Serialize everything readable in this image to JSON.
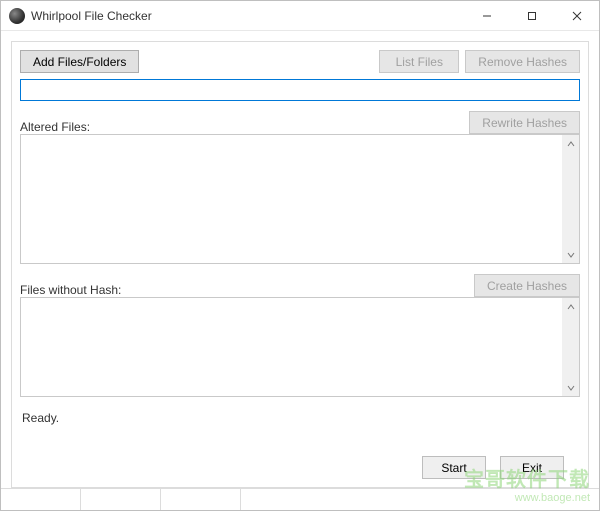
{
  "window": {
    "title": "Whirlpool File Checker"
  },
  "toolbar": {
    "add_label": "Add Files/Folders",
    "list_label": "List Files",
    "remove_label": "Remove Hashes"
  },
  "path_input": {
    "value": "",
    "placeholder": ""
  },
  "altered": {
    "label": "Altered Files:",
    "rewrite_label": "Rewrite Hashes",
    "items": []
  },
  "nohash": {
    "label": "Files without Hash:",
    "create_label": "Create Hashes",
    "items": []
  },
  "status": {
    "text": "Ready."
  },
  "bottom": {
    "start_label": "Start",
    "exit_label": "Exit"
  },
  "watermark": {
    "line1": "宝哥软件下载",
    "line2": "www.baoge.net"
  }
}
